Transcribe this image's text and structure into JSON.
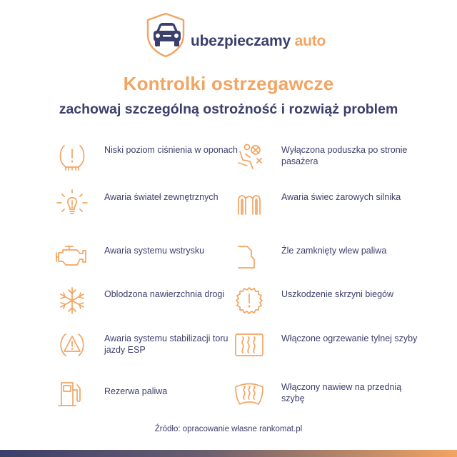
{
  "logo": {
    "word1": "ubezpieczamy",
    "word2": "auto"
  },
  "title": "Kontrolki ostrzegawcze",
  "subtitle": "zachowaj szczególną ostrożność i rozwiąż problem",
  "items": [
    {
      "label": "Niski poziom ciśnienia w oponach",
      "icon": "tire-pressure-icon"
    },
    {
      "label": "Wyłączona poduszka po stronie pasażera",
      "icon": "airbag-off-icon"
    },
    {
      "label": "Awaria świateł zewnętrznych",
      "icon": "exterior-light-icon"
    },
    {
      "label": "Awaria świec żarowych silnika",
      "icon": "glow-plug-icon"
    },
    {
      "label": "Awaria systemu wstrysku",
      "icon": "engine-icon"
    },
    {
      "label": "Źle zamknięty wlew paliwa",
      "icon": "fuel-cap-icon"
    },
    {
      "label": "Oblodzona nawierzchnia drogi",
      "icon": "snowflake-icon"
    },
    {
      "label": "Uszkodzenie skrzyni biegów",
      "icon": "gearbox-icon"
    },
    {
      "label": "Awaria systemu stabilizacji toru jazdy ESP",
      "icon": "esp-warning-icon"
    },
    {
      "label": "Włączone ogrzewanie tylnej szyby",
      "icon": "rear-defrost-icon"
    },
    {
      "label": "Rezerwa paliwa",
      "icon": "fuel-pump-icon"
    },
    {
      "label": "Włączony nawiew na przednią szybę",
      "icon": "front-defrost-icon"
    }
  ],
  "source": "Źródło: opracowanie własne rankomat.pl",
  "colors": {
    "accent": "#f3a462",
    "navy": "#3b3f6b"
  }
}
